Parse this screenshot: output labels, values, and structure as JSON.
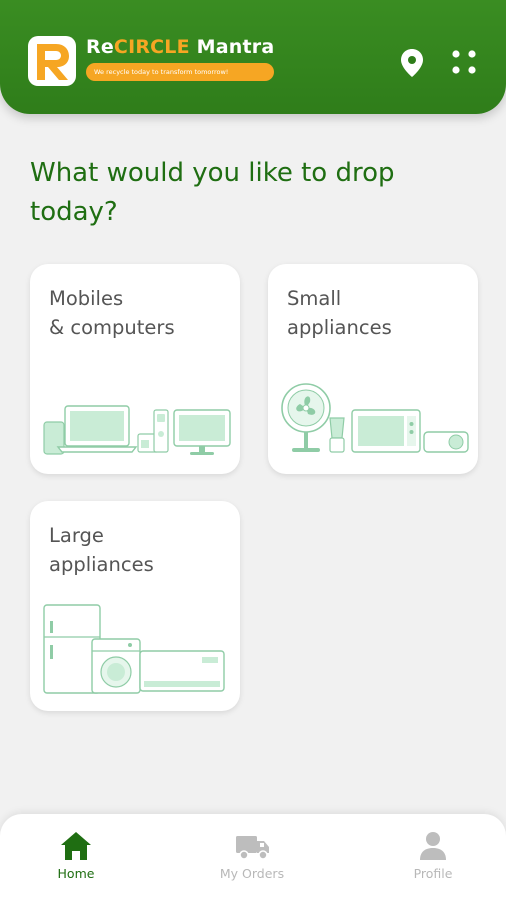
{
  "header": {
    "brand_prefix": "Re",
    "brand_highlight": "CIRCLE",
    "brand_suffix": " Mantra",
    "tagline": "We recycle today to transform tomorrow!",
    "colors": {
      "primary": "#2f7d1a",
      "accent": "#f6a623"
    },
    "icons": {
      "location": "location-pin-icon",
      "menu": "grid-menu-icon"
    }
  },
  "main": {
    "question": "What would you like to drop today?",
    "categories": [
      {
        "label": "Mobiles\n& computers",
        "icon": "electronics-illustration"
      },
      {
        "label": "Small\nappliances",
        "icon": "small-appliances-illustration"
      },
      {
        "label": "Large\nappliances",
        "icon": "large-appliances-illustration"
      }
    ]
  },
  "bottom_nav": {
    "items": [
      {
        "label": "Home",
        "icon": "home-icon",
        "active": true
      },
      {
        "label": "My Orders",
        "icon": "truck-icon",
        "active": false
      },
      {
        "label": "Profile",
        "icon": "profile-icon",
        "active": false
      }
    ],
    "colors": {
      "active": "#1f6e12",
      "inactive": "#b8b8b8"
    }
  }
}
